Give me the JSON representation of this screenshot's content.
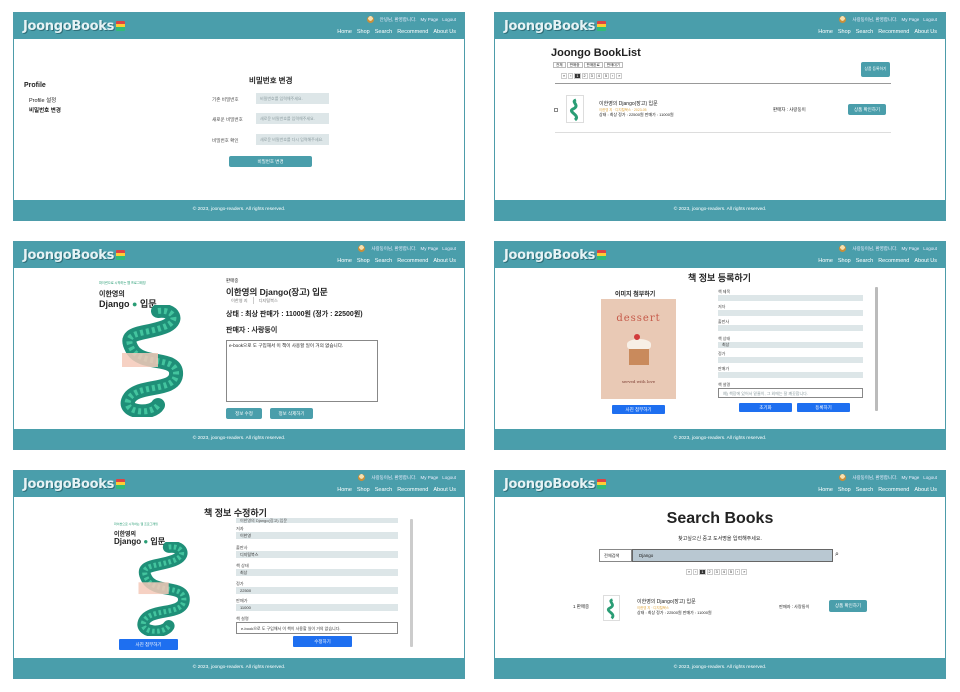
{
  "brand": "JoongoBooks",
  "header": {
    "greeting": "사랑둥이님, 환영합니다.",
    "greeting_short": "안녕님, 환영합니다.",
    "mypage": "My Page",
    "logout": "Logout",
    "nav": [
      "Home",
      "Shop",
      "Search",
      "Recommend",
      "About Us"
    ]
  },
  "footer": "© 2023, joongo-readers. All rights reserved.",
  "p1": {
    "sidebar_title": "Profile",
    "sidebar_items": [
      "Profile 설정",
      "비밀번호 변경"
    ],
    "form_title": "비밀번호 변경",
    "fields": [
      {
        "label": "기존 비밀번호",
        "placeholder": "비밀번호를 입력해주세요."
      },
      {
        "label": "새로운 비밀번호",
        "placeholder": "새로운 비밀번호를 입력해주세요."
      },
      {
        "label": "비밀번호 확인",
        "placeholder": "새로운 비밀번호를 다시 입력해주세요."
      }
    ],
    "submit": "비밀번호 변경"
  },
  "p2": {
    "title": "Joongo BookList",
    "filters": [
      "전체",
      "판매중",
      "판매완료",
      "판매대기"
    ],
    "pages": [
      "«",
      "‹",
      "1",
      "2",
      "3",
      "4",
      "5",
      "›",
      "»"
    ],
    "register": "상품 등록하기",
    "item": {
      "title": "이한영의 Django(장고) 입문",
      "sub": "이한영 지 · 디지털북스 · 2023-05",
      "meta": "상태 : 최상   정가 : 22500원   판매가 : 11000원",
      "seller": "판매자 : 사랑둥이",
      "button": "상품 확인하기"
    }
  },
  "p3": {
    "category": "판매중",
    "title": "이한영의 Django(장고) 입문",
    "tabs": [
      "이한영 지",
      "디지털북스"
    ],
    "price_line": "상태 : 최상    판매가 : 11000원 (정가 : 22500원)",
    "seller": "판매자 : 사랑둥이",
    "description": "e-book으로 도 구입해서 이 책이 사용할 일이 거의 없습니다.",
    "buttons": [
      "정보 수정",
      "정보 삭제하기"
    ],
    "cover_line1": "파이썬으로 시작하는 웹 프로그래밍",
    "cover_title": "이한영의",
    "cover_title2": "Django",
    "cover_title3": "입문"
  },
  "p4": {
    "title": "책 정보 등록하기",
    "image_label": "이미지 첨부하기",
    "cover_word": "dessert",
    "cover_sub": "served with love",
    "attach": "사진 첨부하기",
    "fields": [
      "책 제목",
      "저자",
      "출판사",
      "책 상태",
      "정가",
      "판매가",
      "책 설명"
    ],
    "status_value": "최상",
    "desc_placeholder": "예) 책장에 있어서 밑줄이, 그 외에는 잘 깨끗합니다.",
    "buttons": [
      "초기화",
      "등록하기"
    ]
  },
  "p5": {
    "title": "책 정보 수정하기",
    "fields": [
      {
        "label": "저자",
        "value": "이한영"
      },
      {
        "label": "출판사",
        "value": "디지털북스"
      },
      {
        "label": "책 상태",
        "value": "최상"
      },
      {
        "label": "정가",
        "value": "22500"
      },
      {
        "label": "판매가",
        "value": "11000"
      },
      {
        "label": "책 설명",
        "value": "e-book으로 도 구입해서 이 책이 사용할 일이 거의 없습니다."
      }
    ],
    "top_value": "이한영의 Django(장고) 입문",
    "attach": "사진 첨부하기",
    "submit": "수정하기"
  },
  "p6": {
    "title": "Search Books",
    "subtitle": "찾고싶으신 중고 도서명을 입력해주세요.",
    "select": "전체검색",
    "query": "Django",
    "pages": [
      "«",
      "‹",
      "1",
      "2",
      "3",
      "4",
      "5",
      "›",
      "»"
    ],
    "result": {
      "category": "1 판매중",
      "title": "이한영의 Django(장고) 입문",
      "sub": "이한영 지 · 디지털북스",
      "meta": "상태 : 최상   정가 : 22500원   판매가 : 11000원",
      "seller": "판매자 : 사랑둥이",
      "button": "상품 확인하기"
    }
  },
  "colors": {
    "header": "#4a9eab",
    "button_teal": "#4a9eab",
    "button_blue": "#1e6ff0",
    "field": "#dde6e8"
  }
}
